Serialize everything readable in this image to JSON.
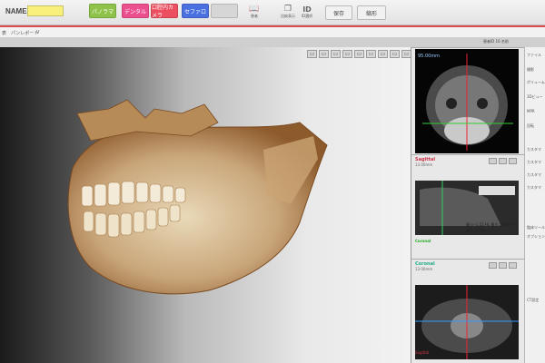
{
  "header": {
    "name_label": "NAME",
    "name_value": "",
    "buttons": [
      "パノラマ",
      "デンタル",
      "口腔内カメラ",
      "セファロ",
      ""
    ],
    "icon_buttons": [
      {
        "icon": "book-icon",
        "label": "患者"
      },
      {
        "icon": "copy-icon",
        "label": "比較表示"
      },
      {
        "icon": "id-icon",
        "label": "ID選択"
      }
    ],
    "save_label": "保存",
    "reset_label": "縮形"
  },
  "subrow": {
    "item1": "表",
    "item2": "パンレポート",
    "item3": "V"
  },
  "top_right": {
    "text": "患者ID  16  名前"
  },
  "viewport": {
    "tools": [
      "▭",
      "▭",
      "▭",
      "▭",
      "▭",
      "▭",
      "▭",
      "▭",
      "▭"
    ]
  },
  "panels": {
    "axial": {
      "title": "",
      "sub": "95.00mm 19.00mm"
    },
    "sagittal": {
      "title": "Sagittal",
      "sub": "13.00mm",
      "label": "Coronal",
      "measure": "最小:-1.52 HL 最大:2076 平均値:1.27 HU"
    },
    "coronal": {
      "title": "Coronal",
      "sub": "13.00mm",
      "label": "Sagittal"
    }
  },
  "sidebar": {
    "items": [
      "ファイル",
      "撮影",
      "ボリューム",
      "3Dビュー",
      "MPR",
      "回転",
      "カスタマ",
      "カスタマ",
      "カスタマ",
      "カスタマ",
      "臨床ツール",
      "オプション",
      "CT設定"
    ]
  },
  "colors": {
    "accent_red": "#d94b4b",
    "green_btn": "#8fc24a",
    "pink_btn": "#ec4f8e",
    "red_btn": "#ec4f5f",
    "blue_btn": "#4a6fe0",
    "name_yellow": "#f7f07a"
  }
}
